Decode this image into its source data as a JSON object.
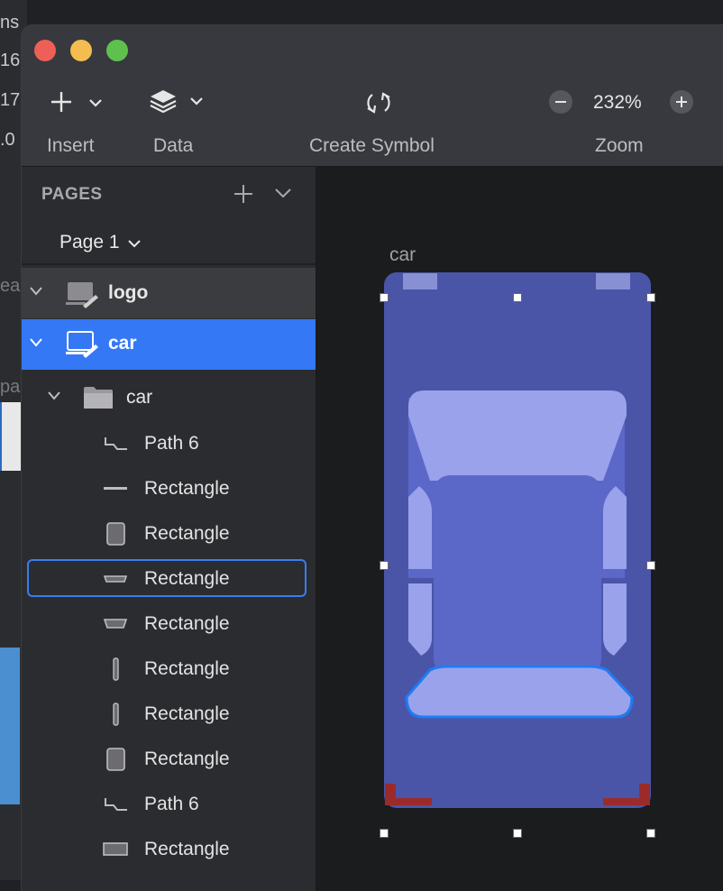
{
  "background": {
    "fragments": [
      "ns",
      "16",
      "17",
      ".0",
      "ea",
      "pa"
    ]
  },
  "toolbar": {
    "insert_label": "Insert",
    "data_label": "Data",
    "create_symbol_label": "Create Symbol",
    "zoom_label": "Zoom",
    "zoom_value": "232%"
  },
  "sidebar": {
    "pages_header": "PAGES",
    "current_page": "Page 1",
    "symbols": [
      {
        "label": "logo"
      },
      {
        "label": "car"
      }
    ],
    "group_label": "car",
    "layers": [
      {
        "label": "Path 6",
        "icon": "path-icon"
      },
      {
        "label": "Rectangle",
        "icon": "line-rect-icon"
      },
      {
        "label": "Rectangle",
        "icon": "rect-icon"
      },
      {
        "label": "Rectangle",
        "icon": "flat-rect-icon"
      },
      {
        "label": "Rectangle",
        "icon": "trapezoid-icon"
      },
      {
        "label": "Rectangle",
        "icon": "thin-rect-icon"
      },
      {
        "label": "Rectangle",
        "icon": "thin-rect-icon"
      },
      {
        "label": "Rectangle",
        "icon": "rect-icon"
      },
      {
        "label": "Path 6",
        "icon": "path-icon"
      },
      {
        "label": "Rectangle",
        "icon": "wide-rect-icon"
      }
    ]
  },
  "canvas": {
    "artboard_label": "car"
  },
  "colors": {
    "accent": "#3478f6",
    "car_body": "#4a55a8",
    "car_cabin": "#5b68c8",
    "car_glass": "#9aa2ec",
    "tail_light": "#9b2b2b"
  }
}
